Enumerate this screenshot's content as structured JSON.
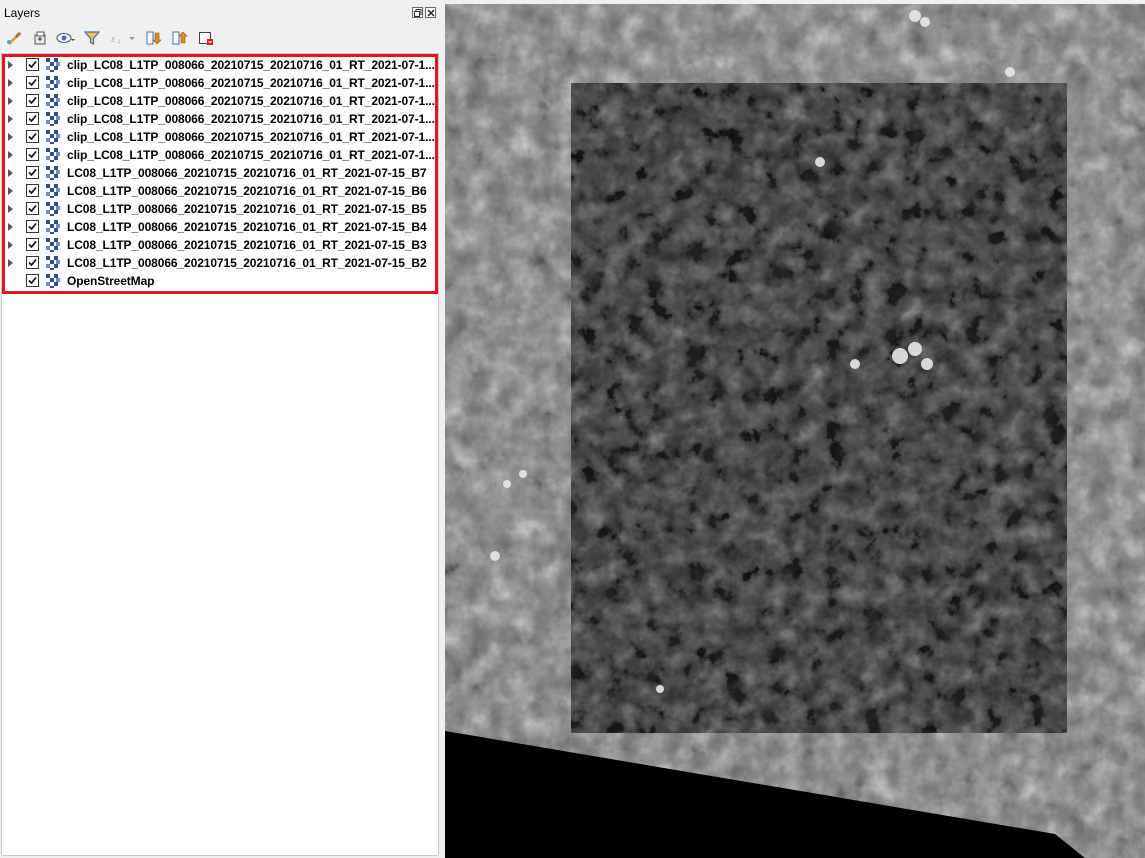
{
  "panel": {
    "title": "Layers",
    "float_icon": "float-icon",
    "close_icon": "close-icon"
  },
  "toolbar": [
    {
      "name": "style-manager-icon"
    },
    {
      "name": "add-group-icon"
    },
    {
      "name": "manage-visibility-icon"
    },
    {
      "name": "filter-legend-icon"
    },
    {
      "name": "filter-expression-icon"
    },
    {
      "name": "expand-all-icon"
    },
    {
      "name": "collapse-all-icon"
    },
    {
      "name": "remove-layer-icon"
    }
  ],
  "layers": [
    {
      "name": "clip_LC08_L1TP_008066_20210715_20210716_01_RT_2021-07-1...",
      "checked": true,
      "expandable": true
    },
    {
      "name": "clip_LC08_L1TP_008066_20210715_20210716_01_RT_2021-07-1...",
      "checked": true,
      "expandable": true
    },
    {
      "name": "clip_LC08_L1TP_008066_20210715_20210716_01_RT_2021-07-1...",
      "checked": true,
      "expandable": true
    },
    {
      "name": "clip_LC08_L1TP_008066_20210715_20210716_01_RT_2021-07-1...",
      "checked": true,
      "expandable": true
    },
    {
      "name": "clip_LC08_L1TP_008066_20210715_20210716_01_RT_2021-07-1...",
      "checked": true,
      "expandable": true
    },
    {
      "name": "clip_LC08_L1TP_008066_20210715_20210716_01_RT_2021-07-1...",
      "checked": true,
      "expandable": true
    },
    {
      "name": "LC08_L1TP_008066_20210715_20210716_01_RT_2021-07-15_B7",
      "checked": true,
      "expandable": true
    },
    {
      "name": "LC08_L1TP_008066_20210715_20210716_01_RT_2021-07-15_B6",
      "checked": true,
      "expandable": true
    },
    {
      "name": "LC08_L1TP_008066_20210715_20210716_01_RT_2021-07-15_B5",
      "checked": true,
      "expandable": true
    },
    {
      "name": "LC08_L1TP_008066_20210715_20210716_01_RT_2021-07-15_B4",
      "checked": true,
      "expandable": true
    },
    {
      "name": "LC08_L1TP_008066_20210715_20210716_01_RT_2021-07-15_B3",
      "checked": true,
      "expandable": true
    },
    {
      "name": "LC08_L1TP_008066_20210715_20210716_01_RT_2021-07-15_B2",
      "checked": true,
      "expandable": true
    },
    {
      "name": "OpenStreetMap",
      "checked": true,
      "expandable": false
    }
  ],
  "colors": {
    "highlight": "#e5151f",
    "map_base": "#6e6e6e",
    "clip_overlay": "#262626"
  }
}
